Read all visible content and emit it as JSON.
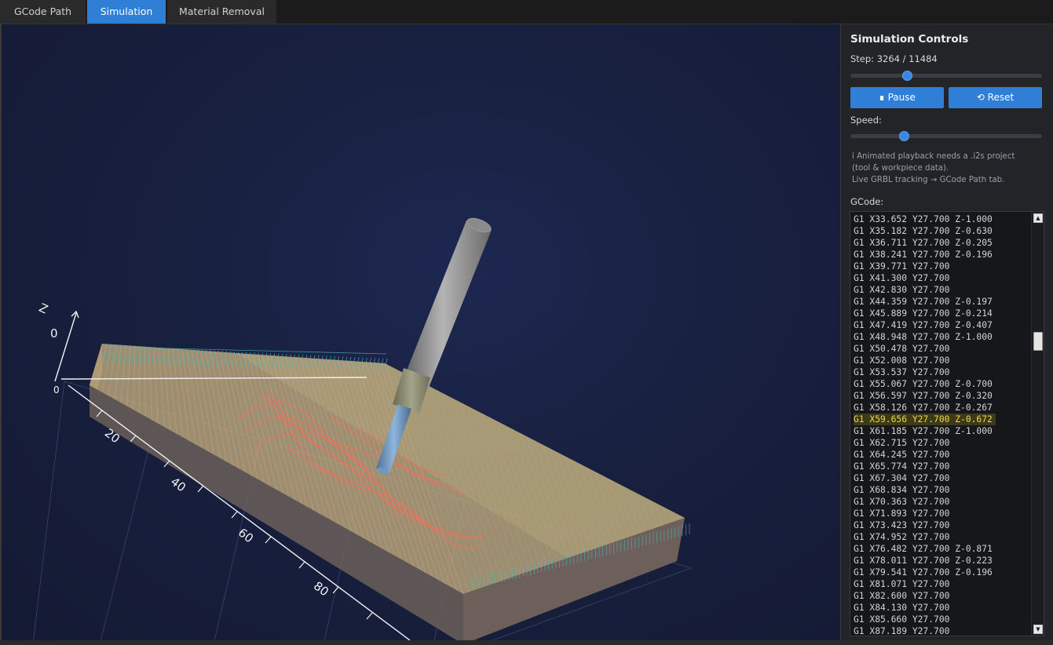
{
  "tabs": [
    {
      "label": "GCode Path",
      "active": false
    },
    {
      "label": "Simulation",
      "active": true
    },
    {
      "label": "Material Removal",
      "active": false
    }
  ],
  "panel": {
    "title": "Simulation Controls",
    "step_label": "Step: 3264 / 11484",
    "step_current": 3264,
    "step_total": 11484,
    "pause_label": "∎ Pause",
    "reset_label": "⟲ Reset",
    "speed_label": "Speed:",
    "speed_fraction": 0.27,
    "info": [
      "i Animated playback needs a .i2s project",
      "(tool & workpiece data).",
      "Live GRBL tracking → GCode Path tab."
    ],
    "gcode_label": "GCode:",
    "gcode_lines": [
      "G1 X33.652 Y27.700 Z-1.000",
      "G1 X35.182 Y27.700 Z-0.630",
      "G1 X36.711 Y27.700 Z-0.205",
      "G1 X38.241 Y27.700 Z-0.196",
      "G1 X39.771 Y27.700",
      "G1 X41.300 Y27.700",
      "G1 X42.830 Y27.700",
      "G1 X44.359 Y27.700 Z-0.197",
      "G1 X45.889 Y27.700 Z-0.214",
      "G1 X47.419 Y27.700 Z-0.407",
      "G1 X48.948 Y27.700 Z-1.000",
      "G1 X50.478 Y27.700",
      "G1 X52.008 Y27.700",
      "G1 X53.537 Y27.700",
      "G1 X55.067 Y27.700 Z-0.700",
      "G1 X56.597 Y27.700 Z-0.320",
      "G1 X58.126 Y27.700 Z-0.267",
      "G1 X59.656 Y27.700 Z-0.672",
      "G1 X61.185 Y27.700 Z-1.000",
      "G1 X62.715 Y27.700",
      "G1 X64.245 Y27.700",
      "G1 X65.774 Y27.700",
      "G1 X67.304 Y27.700",
      "G1 X68.834 Y27.700",
      "G1 X70.363 Y27.700",
      "G1 X71.893 Y27.700",
      "G1 X73.423 Y27.700",
      "G1 X74.952 Y27.700",
      "G1 X76.482 Y27.700 Z-0.871",
      "G1 X78.011 Y27.700 Z-0.223",
      "G1 X79.541 Y27.700 Z-0.196",
      "G1 X81.071 Y27.700",
      "G1 X82.600 Y27.700",
      "G1 X84.130 Y27.700",
      "G1 X85.660 Y27.700",
      "G1 X87.189 Y27.700"
    ],
    "highlighted_line": 17
  },
  "viewport": {
    "axis_labels": {
      "z_letter": "Z",
      "z_zero": "0",
      "x_ticks": [
        "20",
        "40",
        "60",
        "80"
      ],
      "origin_zero": "0"
    }
  },
  "colors": {
    "accent": "#2f7fd6",
    "toolpath": "#ff6a5a",
    "stock_top": "#c9b483"
  }
}
